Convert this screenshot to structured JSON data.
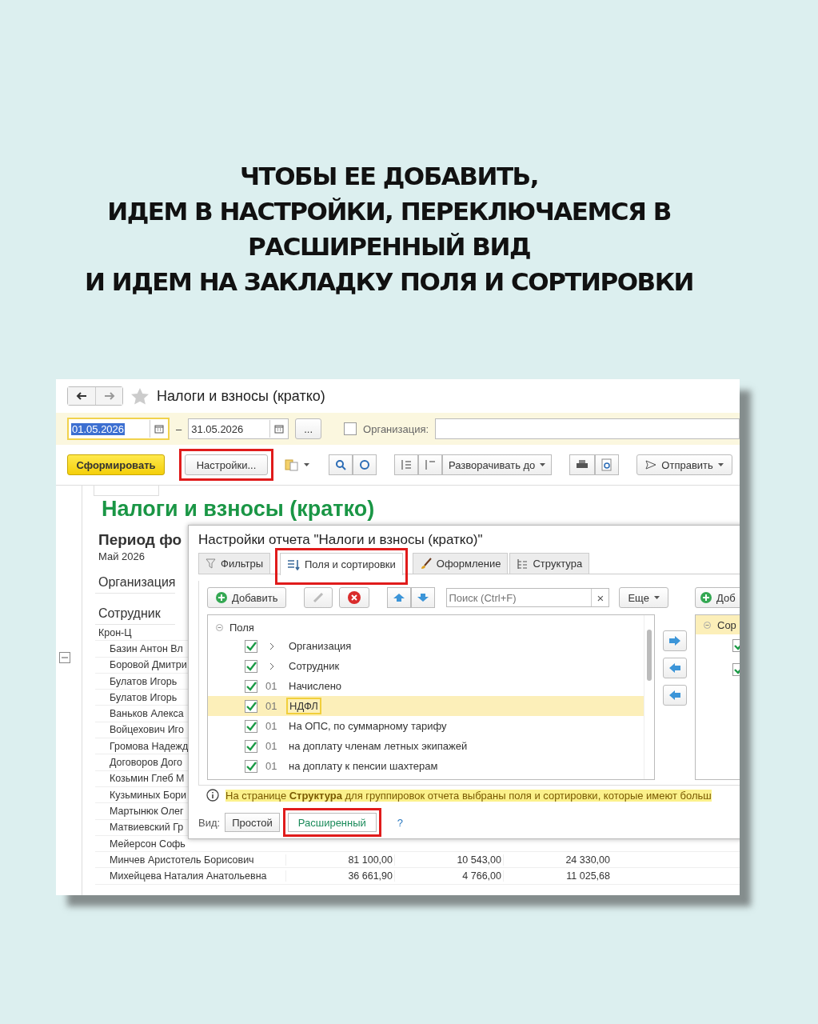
{
  "headline": [
    "ЧТОБЫ ЕЕ ДОБАВИТЬ,",
    "ИДЕМ В НАСТРОЙКИ, ПЕРЕКЛЮЧАЕМСЯ В",
    "РАСШИРЕННЫЙ ВИД",
    "И ИДЕМ НА ЗАКЛАДКУ ПОЛЯ И СОРТИРОВКИ"
  ],
  "window": {
    "title": "Налоги и взносы (кратко)"
  },
  "period": {
    "start": "01.05.2026",
    "separator": "–",
    "end": "31.05.2026",
    "more": "...",
    "organization_checked": false,
    "organization_label": "Организация:"
  },
  "toolbar": {
    "generate": "Сформировать",
    "settings": {
      "label": "Настройки...",
      "highlighted": true
    },
    "expand": "Разворачивать до",
    "send": "Отправить"
  },
  "report": {
    "title": "Налоги и взносы (кратко)",
    "period_label": "Период фо",
    "period_value": "Май 2026",
    "organization_label": "Организация",
    "employee_label": "Сотрудник",
    "group": "Крон-Ц",
    "rows": [
      {
        "name": "Базин Антон Вл",
        "values": []
      },
      {
        "name": "Боровой Дмитри",
        "values": []
      },
      {
        "name": "Булатов Игорь",
        "values": []
      },
      {
        "name": "Булатов Игорь",
        "values": []
      },
      {
        "name": "Ваньков Алекса",
        "values": []
      },
      {
        "name": "Войцехович Иго",
        "values": []
      },
      {
        "name": "Громова Надежд",
        "values": []
      },
      {
        "name": "Договоров Дого",
        "values": []
      },
      {
        "name": "Козьмин Глеб М",
        "values": []
      },
      {
        "name": "Кузьминых Бори",
        "values": []
      },
      {
        "name": "Мартынюк Олег",
        "values": []
      },
      {
        "name": "Матвиевский Гр",
        "values": []
      },
      {
        "name": "Мейерсон Софь",
        "values": []
      },
      {
        "name": "Минчев Аристотель Борисович",
        "values": [
          "81 100,00",
          "10 543,00",
          "24 330,00"
        ]
      },
      {
        "name": "Михейцева Наталия Анатольевна",
        "values": [
          "36 661,90",
          "4 766,00",
          "11 025,68"
        ]
      }
    ]
  },
  "dialog": {
    "title": "Настройки отчета \"Налоги и взносы (кратко)\"",
    "tabs": [
      {
        "kind": "filter",
        "label": "Фильтры",
        "selected": false,
        "highlighted": false
      },
      {
        "kind": "fields",
        "label": "Поля и сортировки",
        "selected": true,
        "highlighted": true
      },
      {
        "kind": "brush",
        "label": "Оформление",
        "selected": false,
        "highlighted": false
      },
      {
        "kind": "structure",
        "label": "Структура",
        "selected": false,
        "highlighted": false
      }
    ],
    "add": "Добавить",
    "search_placeholder": "Поиск (Ctrl+F)",
    "clear": "×",
    "more": "Еще",
    "tree": {
      "root": "Поля",
      "items": [
        {
          "kind": "group",
          "label": "Организация",
          "checked": true,
          "selected": false
        },
        {
          "kind": "group",
          "label": "Сотрудник",
          "checked": true,
          "selected": false
        },
        {
          "kind": "field",
          "code": "01",
          "label": "Начислено",
          "checked": true,
          "selected": false
        },
        {
          "kind": "field",
          "code": "01",
          "label": "НДФЛ",
          "checked": true,
          "selected": true
        },
        {
          "kind": "field",
          "code": "01",
          "label": "На ОПС, по суммарному тарифу",
          "checked": true,
          "selected": false
        },
        {
          "kind": "field",
          "code": "01",
          "label": "на доплату членам летных экипажей",
          "checked": true,
          "selected": false
        },
        {
          "kind": "field",
          "code": "01",
          "label": "на доплату к пенсии шахтерам",
          "checked": true,
          "selected": false
        }
      ]
    },
    "right_pane": {
      "add": "Доб",
      "root": "Сор",
      "items": [
        {
          "checked": true
        },
        {
          "checked": true
        }
      ]
    },
    "info": "На странице **Структура** для группировок отчета выбраны поля и сортировки, которые имеют больш",
    "view_label": "Вид:",
    "views": [
      {
        "label": "Простой",
        "selected": false,
        "highlighted": false
      },
      {
        "label": "Расширенный",
        "selected": true,
        "highlighted": true
      }
    ],
    "help": "?"
  }
}
